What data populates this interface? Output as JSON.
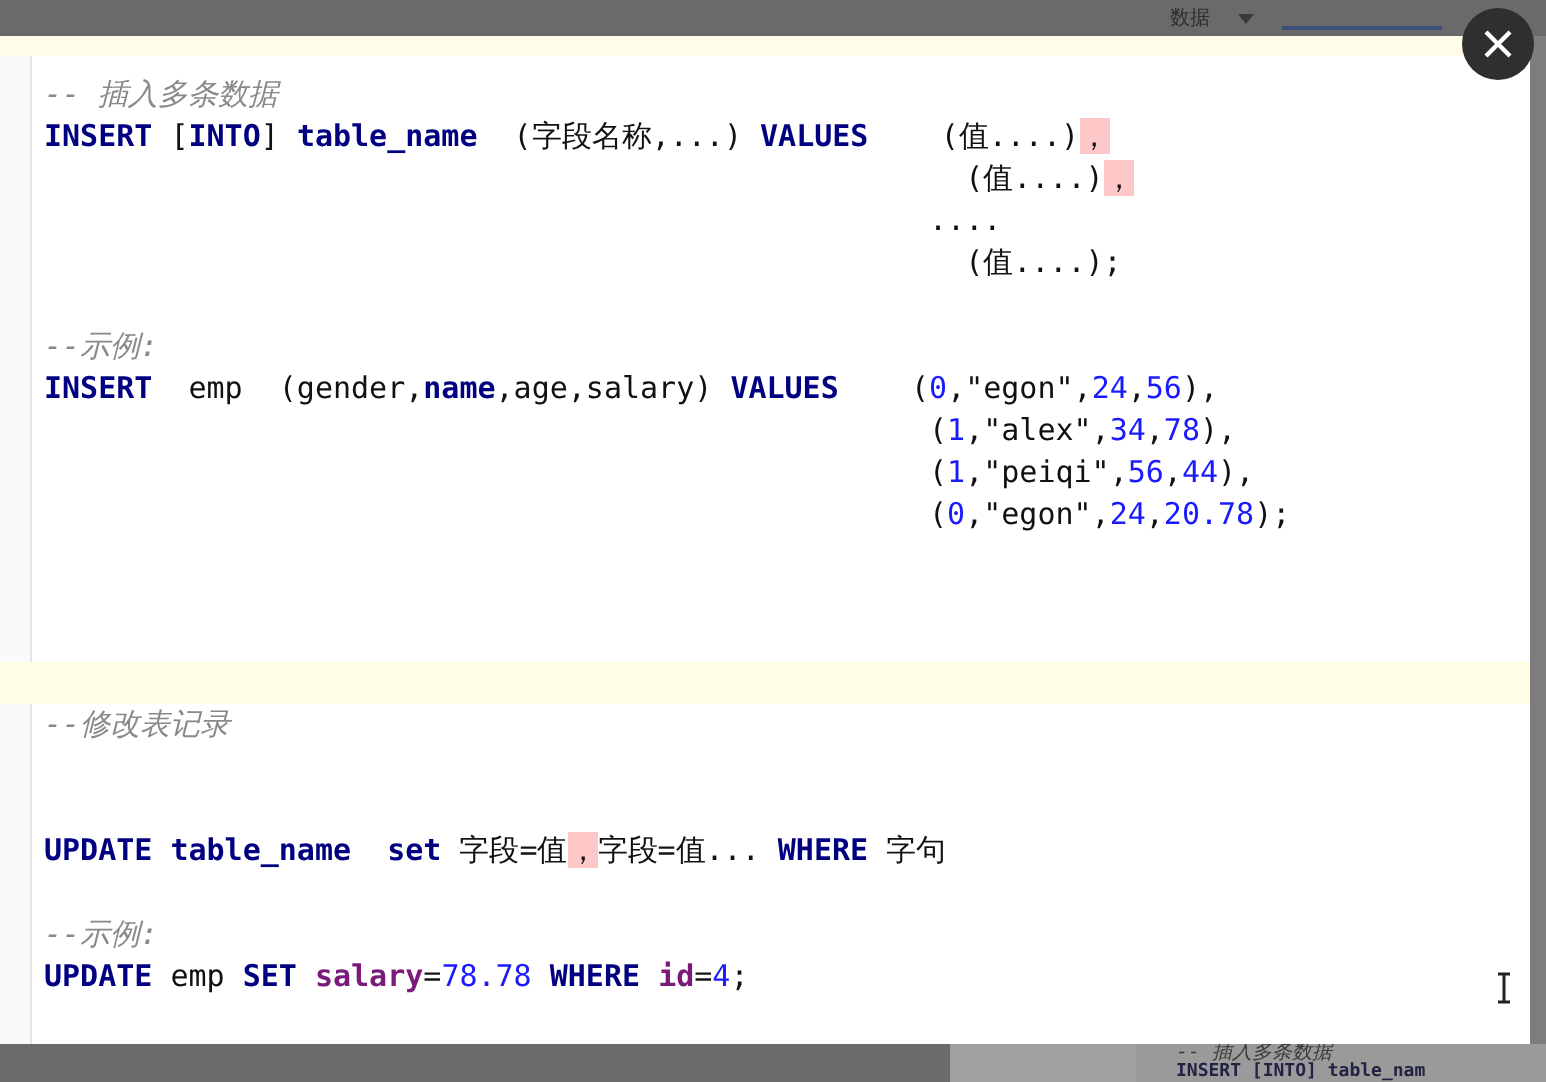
{
  "background_window": {
    "menu_label": "数据",
    "bottom_snippet": [
      "-- 插入多条数据",
      "INSERT [INTO] table_nam"
    ]
  },
  "editor": {
    "lines": [
      {
        "current": false,
        "tokens": [
          {
            "kind": "comment",
            "text": "-- 插入多条数据"
          }
        ]
      },
      {
        "current": false,
        "tokens": [
          {
            "kind": "keyword",
            "text": "INSERT"
          },
          {
            "kind": "plain",
            "text": " ["
          },
          {
            "kind": "keyword",
            "text": "INTO"
          },
          {
            "kind": "plain",
            "text": "] "
          },
          {
            "kind": "keyword",
            "text": "table_name"
          },
          {
            "kind": "plain",
            "text": "  (字段名称,...) "
          },
          {
            "kind": "keyword",
            "text": "VALUES"
          },
          {
            "kind": "plain",
            "text": "    (值....)"
          },
          {
            "kind": "error",
            "text": "，"
          }
        ]
      },
      {
        "current": false,
        "tokens": [
          {
            "kind": "plain",
            "text": "                                                   (值....)"
          },
          {
            "kind": "error",
            "text": "，"
          }
        ]
      },
      {
        "current": false,
        "tokens": [
          {
            "kind": "plain",
            "text": "                                                 ...."
          }
        ]
      },
      {
        "current": false,
        "tokens": [
          {
            "kind": "plain",
            "text": "                                                   (值....);"
          }
        ]
      },
      {
        "current": false
      },
      {
        "current": false,
        "tokens": [
          {
            "kind": "comment",
            "text": "--示例:"
          }
        ]
      },
      {
        "current": false,
        "tokens": [
          {
            "kind": "keyword",
            "text": "INSERT"
          },
          {
            "kind": "plain",
            "text": "  emp  (gender,"
          },
          {
            "kind": "keyword",
            "text": "name"
          },
          {
            "kind": "plain",
            "text": ",age,salary) "
          },
          {
            "kind": "keyword",
            "text": "VALUES"
          },
          {
            "kind": "plain",
            "text": "    ("
          },
          {
            "kind": "number",
            "text": "0"
          },
          {
            "kind": "plain",
            "text": ",\"egon\","
          },
          {
            "kind": "number",
            "text": "24"
          },
          {
            "kind": "plain",
            "text": ","
          },
          {
            "kind": "number",
            "text": "56"
          },
          {
            "kind": "plain",
            "text": "),"
          }
        ]
      },
      {
        "current": false,
        "tokens": [
          {
            "kind": "plain",
            "text": "                                                 ("
          },
          {
            "kind": "number",
            "text": "1"
          },
          {
            "kind": "plain",
            "text": ",\"alex\","
          },
          {
            "kind": "number",
            "text": "34"
          },
          {
            "kind": "plain",
            "text": ","
          },
          {
            "kind": "number",
            "text": "78"
          },
          {
            "kind": "plain",
            "text": "),"
          }
        ]
      },
      {
        "current": false,
        "tokens": [
          {
            "kind": "plain",
            "text": "                                                 ("
          },
          {
            "kind": "number",
            "text": "1"
          },
          {
            "kind": "plain",
            "text": ",\"peiqi\","
          },
          {
            "kind": "number",
            "text": "56"
          },
          {
            "kind": "plain",
            "text": ","
          },
          {
            "kind": "number",
            "text": "44"
          },
          {
            "kind": "plain",
            "text": "),"
          }
        ]
      },
      {
        "current": false,
        "tokens": [
          {
            "kind": "plain",
            "text": "                                                 ("
          },
          {
            "kind": "number",
            "text": "0"
          },
          {
            "kind": "plain",
            "text": ",\"egon\","
          },
          {
            "kind": "number",
            "text": "24"
          },
          {
            "kind": "plain",
            "text": ","
          },
          {
            "kind": "number",
            "text": "20.78"
          },
          {
            "kind": "plain",
            "text": ");"
          }
        ]
      },
      {
        "current": false
      },
      {
        "current": false
      },
      {
        "current": false
      },
      {
        "current": true
      },
      {
        "current": false,
        "tokens": [
          {
            "kind": "comment",
            "text": "--修改表记录"
          }
        ]
      },
      {
        "current": false
      },
      {
        "current": false
      },
      {
        "current": false,
        "tokens": [
          {
            "kind": "keyword",
            "text": "UPDATE table_name  set"
          },
          {
            "kind": "plain",
            "text": " 字段=值"
          },
          {
            "kind": "error",
            "text": "，"
          },
          {
            "kind": "plain",
            "text": "字段=值... "
          },
          {
            "kind": "keyword",
            "text": "WHERE"
          },
          {
            "kind": "plain",
            "text": " 字句"
          }
        ]
      },
      {
        "current": false
      },
      {
        "current": false,
        "tokens": [
          {
            "kind": "comment",
            "text": "--示例:"
          }
        ]
      },
      {
        "current": false,
        "tokens": [
          {
            "kind": "keyword",
            "text": "UPDATE"
          },
          {
            "kind": "plain",
            "text": " emp "
          },
          {
            "kind": "keyword",
            "text": "SET "
          },
          {
            "kind": "column",
            "text": "salary"
          },
          {
            "kind": "plain",
            "text": "="
          },
          {
            "kind": "number",
            "text": "78.78"
          },
          {
            "kind": "keyword",
            "text": " WHERE "
          },
          {
            "kind": "column",
            "text": "id"
          },
          {
            "kind": "plain",
            "text": "="
          },
          {
            "kind": "number",
            "text": "4"
          },
          {
            "kind": "plain",
            "text": ";"
          }
        ]
      }
    ]
  }
}
